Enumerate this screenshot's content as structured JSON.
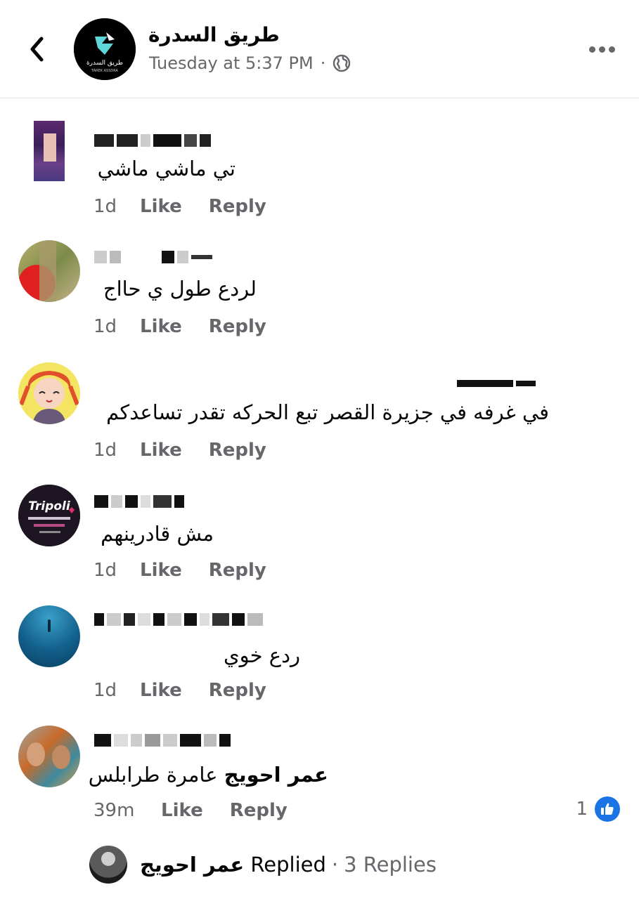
{
  "header": {
    "page_name": "طريق السدرة",
    "timestamp": "Tuesday at 5:37 PM",
    "separator": "·",
    "audience_icon": "globe-icon",
    "logo_text_ar": "طريق السدرة",
    "logo_text_en": "TAREK ASSDRA"
  },
  "comments": [
    {
      "text": "تي ماشي ماشي",
      "time": "1d",
      "like_label": "Like",
      "reply_label": "Reply"
    },
    {
      "text": "لردع طول ي حااج",
      "time": "1d",
      "like_label": "Like",
      "reply_label": "Reply"
    },
    {
      "text": "في غرفه في جزيرة القصر تبع الحركه تقدر تساعدكم",
      "time": "1d",
      "like_label": "Like",
      "reply_label": "Reply"
    },
    {
      "text": "مش قادرينهم",
      "time": "1d",
      "like_label": "Like",
      "reply_label": "Reply",
      "avatar_text": "Tripoli"
    },
    {
      "text": "ردع  خوي",
      "time": "1d",
      "like_label": "Like",
      "reply_label": "Reply"
    },
    {
      "text_bold": "عمر احويج",
      "text_rest": " عامرة طرابلس",
      "time": "39m",
      "like_label": "Like",
      "reply_label": "Reply",
      "like_count": "1"
    }
  ],
  "replies": {
    "name": "عمر احويج",
    "replied_label": "Replied",
    "separator": "·",
    "count_label": "3 Replies"
  },
  "colors": {
    "primary_text": "#050505",
    "secondary_text": "#65676b",
    "like_blue": "#1b74e4",
    "divider": "#e4e6eb"
  }
}
